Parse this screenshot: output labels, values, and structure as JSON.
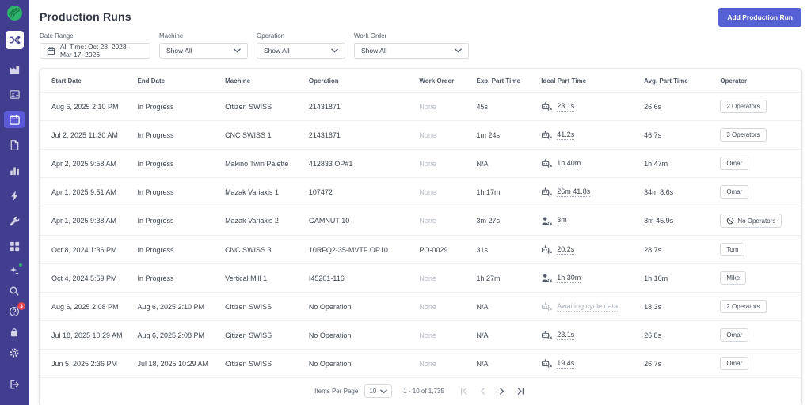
{
  "app": {
    "accent_color": "#5560d4",
    "sidebar_color": "#413e8f",
    "active_item_color": "#5b59d8",
    "logo_color": "#2db36b"
  },
  "sidebar": {
    "logo_icon": "leaf-logo-icon",
    "top_items": [
      {
        "icon": "shuffle-icon",
        "variant": "launcher"
      },
      {
        "icon": "factory-icon"
      },
      {
        "icon": "badge-icon"
      },
      {
        "icon": "calendar-icon",
        "active": true
      },
      {
        "icon": "document-icon"
      },
      {
        "icon": "bar-chart-icon"
      },
      {
        "icon": "lightning-icon"
      },
      {
        "icon": "wrench-icon"
      },
      {
        "icon": "grid-icon"
      }
    ],
    "bottom_items": [
      {
        "icon": "sparkle-icon",
        "dot": true
      },
      {
        "icon": "search-icon"
      },
      {
        "icon": "help-icon",
        "badge": "3"
      },
      {
        "icon": "lock-icon"
      },
      {
        "icon": "gear-icon"
      },
      {
        "icon": "logout-icon",
        "logout": true
      }
    ]
  },
  "header": {
    "title": "Production Runs",
    "add_button_label": "Add Production Run"
  },
  "filters": {
    "date_range": {
      "label": "Date Range",
      "value": "All Time: Oct 28, 2023 - Mar 17, 2026"
    },
    "machine": {
      "label": "Machine",
      "value": "Show All"
    },
    "operation": {
      "label": "Operation",
      "value": "Show All"
    },
    "work_order": {
      "label": "Work Order",
      "value": "Show All"
    }
  },
  "table": {
    "columns": [
      "Start Date",
      "End Date",
      "Machine",
      "Operation",
      "Work Order",
      "Exp. Part Time",
      "Ideal Part Time",
      "Avg. Part Time",
      "Operator"
    ],
    "rows": [
      {
        "start_date": "Aug 6, 2025 2:10 PM",
        "end_date": "In Progress",
        "machine": "Citizen SWISS",
        "operation": "21431871",
        "work_order": "None",
        "exp_part_time": "45s",
        "ideal_part_time": "23.1s",
        "ideal_source": "robot",
        "ideal_awaiting": false,
        "avg_part_time": "26.6s",
        "operator": "2 Operators",
        "no_operators": false
      },
      {
        "start_date": "Jul 2, 2025 11:30 AM",
        "end_date": "In Progress",
        "machine": "CNC SWISS 1",
        "operation": "21431871",
        "work_order": "None",
        "exp_part_time": "1m 24s",
        "ideal_part_time": "41.2s",
        "ideal_source": "robot",
        "ideal_awaiting": false,
        "avg_part_time": "46.7s",
        "operator": "3 Operators",
        "no_operators": false
      },
      {
        "start_date": "Apr 2, 2025 9:58 AM",
        "end_date": "In Progress",
        "machine": "Makino Twin Palette",
        "operation": "412833 OP#1",
        "work_order": "None",
        "exp_part_time": "N/A",
        "ideal_part_time": "1h 40m",
        "ideal_source": "robot",
        "ideal_awaiting": false,
        "avg_part_time": "1h 47m",
        "operator": "Omar",
        "no_operators": false
      },
      {
        "start_date": "Apr 1, 2025 9:51 AM",
        "end_date": "In Progress",
        "machine": "Mazak Variaxis 1",
        "operation": "107472",
        "work_order": "None",
        "exp_part_time": "1h 17m",
        "ideal_part_time": "26m 41.8s",
        "ideal_source": "robot",
        "ideal_awaiting": false,
        "avg_part_time": "34m 8.6s",
        "operator": "Omar",
        "no_operators": false
      },
      {
        "start_date": "Apr 1, 2025 9:38 AM",
        "end_date": "In Progress",
        "machine": "Mazak Variaxis 2",
        "operation": "GAMNUT 10",
        "work_order": "None",
        "exp_part_time": "3m 27s",
        "ideal_part_time": "3m",
        "ideal_source": "person",
        "ideal_awaiting": false,
        "avg_part_time": "8m 45.9s",
        "operator": "No Operators",
        "no_operators": true
      },
      {
        "start_date": "Oct 8, 2024 1:36 PM",
        "end_date": "In Progress",
        "machine": "CNC SWISS 3",
        "operation": "10RFQ2-35-MVTF OP10",
        "work_order": "PO-0029",
        "exp_part_time": "31s",
        "ideal_part_time": "20.2s",
        "ideal_source": "robot",
        "ideal_awaiting": false,
        "avg_part_time": "28.7s",
        "operator": "Tom",
        "no_operators": false
      },
      {
        "start_date": "Oct 4, 2024 5:59 PM",
        "end_date": "In Progress",
        "machine": "Vertical Mill 1",
        "operation": "I45201-116",
        "work_order": "None",
        "exp_part_time": "1h 27m",
        "ideal_part_time": "1h 30m",
        "ideal_source": "person",
        "ideal_awaiting": false,
        "avg_part_time": "1h 10m",
        "operator": "Mike",
        "no_operators": false
      },
      {
        "start_date": "Aug 6, 2025 2:08 PM",
        "end_date": "Aug 6, 2025 2:10 PM",
        "machine": "Citizen SWISS",
        "operation": "No Operation",
        "work_order": "None",
        "exp_part_time": "N/A",
        "ideal_part_time": "Awaiting cycle data",
        "ideal_source": "robot",
        "ideal_awaiting": true,
        "avg_part_time": "18.3s",
        "operator": "2 Operators",
        "no_operators": false
      },
      {
        "start_date": "Jul 18, 2025 10:29 AM",
        "end_date": "Aug 6, 2025 2:08 PM",
        "machine": "Citizen SWISS",
        "operation": "No Operation",
        "work_order": "None",
        "exp_part_time": "N/A",
        "ideal_part_time": "23.1s",
        "ideal_source": "robot",
        "ideal_awaiting": false,
        "avg_part_time": "26.8s",
        "operator": "Omar",
        "no_operators": false
      },
      {
        "start_date": "Jun 5, 2025 2:36 PM",
        "end_date": "Jul 18, 2025 10:29 AM",
        "machine": "Citizen SWISS",
        "operation": "No Operation",
        "work_order": "None",
        "exp_part_time": "N/A",
        "ideal_part_time": "19.4s",
        "ideal_source": "robot",
        "ideal_awaiting": false,
        "avg_part_time": "26.7s",
        "operator": "Omar",
        "no_operators": false
      }
    ]
  },
  "pagination": {
    "items_per_page_label": "Items Per Page",
    "items_per_page": "10",
    "range_label": "1 - 10 of 1,735"
  }
}
